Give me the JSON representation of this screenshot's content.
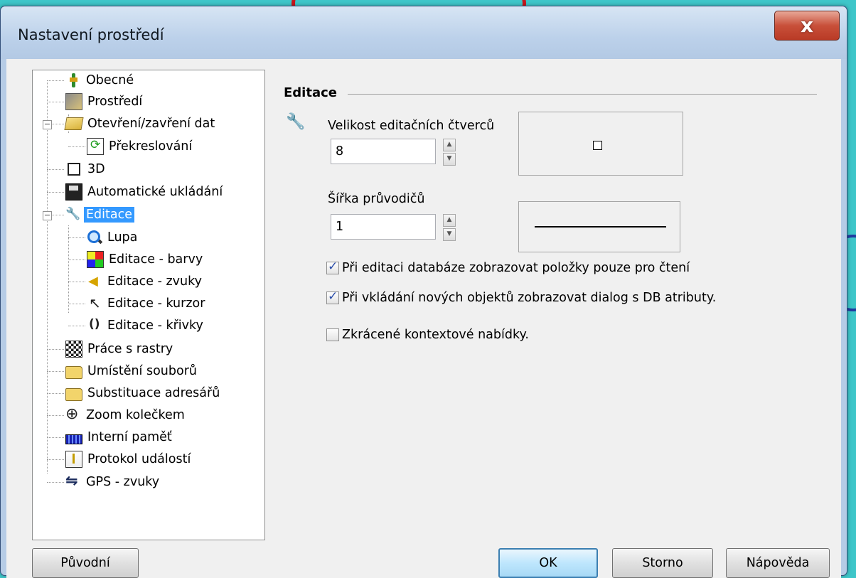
{
  "window": {
    "title": "Nastavení prostředí",
    "close_glyph": "x"
  },
  "tree": {
    "items": [
      {
        "label": "Obecné",
        "icon": "pin-icon"
      },
      {
        "label": "Prostředí",
        "icon": "environment-icon"
      },
      {
        "label": "Otevření/zavření dat",
        "icon": "open-folder-icon"
      },
      {
        "label": "Překreslování",
        "icon": "redraw-icon"
      },
      {
        "label": "3D",
        "icon": "cube-icon"
      },
      {
        "label": "Automatické ukládání",
        "icon": "floppy-icon"
      },
      {
        "label": "Editace",
        "icon": "wrench-icon",
        "selected": true
      },
      {
        "label": "Lupa",
        "icon": "magnifier-icon"
      },
      {
        "label": "Editace - barvy",
        "icon": "colors-icon"
      },
      {
        "label": "Editace - zvuky",
        "icon": "speaker-icon"
      },
      {
        "label": "Editace - kurzor",
        "icon": "cursor-icon"
      },
      {
        "label": "Editace - křivky",
        "icon": "curve-icon"
      },
      {
        "label": "Práce s rastry",
        "icon": "raster-icon"
      },
      {
        "label": "Umístění souborů",
        "icon": "folder-icon"
      },
      {
        "label": "Substituace adresářů",
        "icon": "folder-icon"
      },
      {
        "label": "Zoom kolečkem",
        "icon": "zoom-icon"
      },
      {
        "label": "Interní paměť",
        "icon": "memory-icon"
      },
      {
        "label": "Protokol událostí",
        "icon": "log-icon"
      },
      {
        "label": "GPS - zvuky",
        "icon": "gps-icon"
      }
    ]
  },
  "editace": {
    "group_title": "Editace",
    "square_size": {
      "label": "Velikost editačních čtverců",
      "value": "8"
    },
    "guide_width": {
      "label": "Šířka průvodičů",
      "value": "1"
    },
    "checkboxes": [
      {
        "label": "Při editaci databáze zobrazovat položky pouze pro čtení",
        "checked": true
      },
      {
        "label": "Při vkládání nových objektů zobrazovat dialog s DB atributy.",
        "checked": true
      },
      {
        "label": "Zkrácené kontextové nabídky.",
        "checked": false
      }
    ]
  },
  "buttons": {
    "default_label": "Původní",
    "ok_label": "OK",
    "cancel_label": "Storno",
    "help_label": "Nápověda"
  },
  "spin": {
    "up": "▲",
    "down": "▼"
  }
}
